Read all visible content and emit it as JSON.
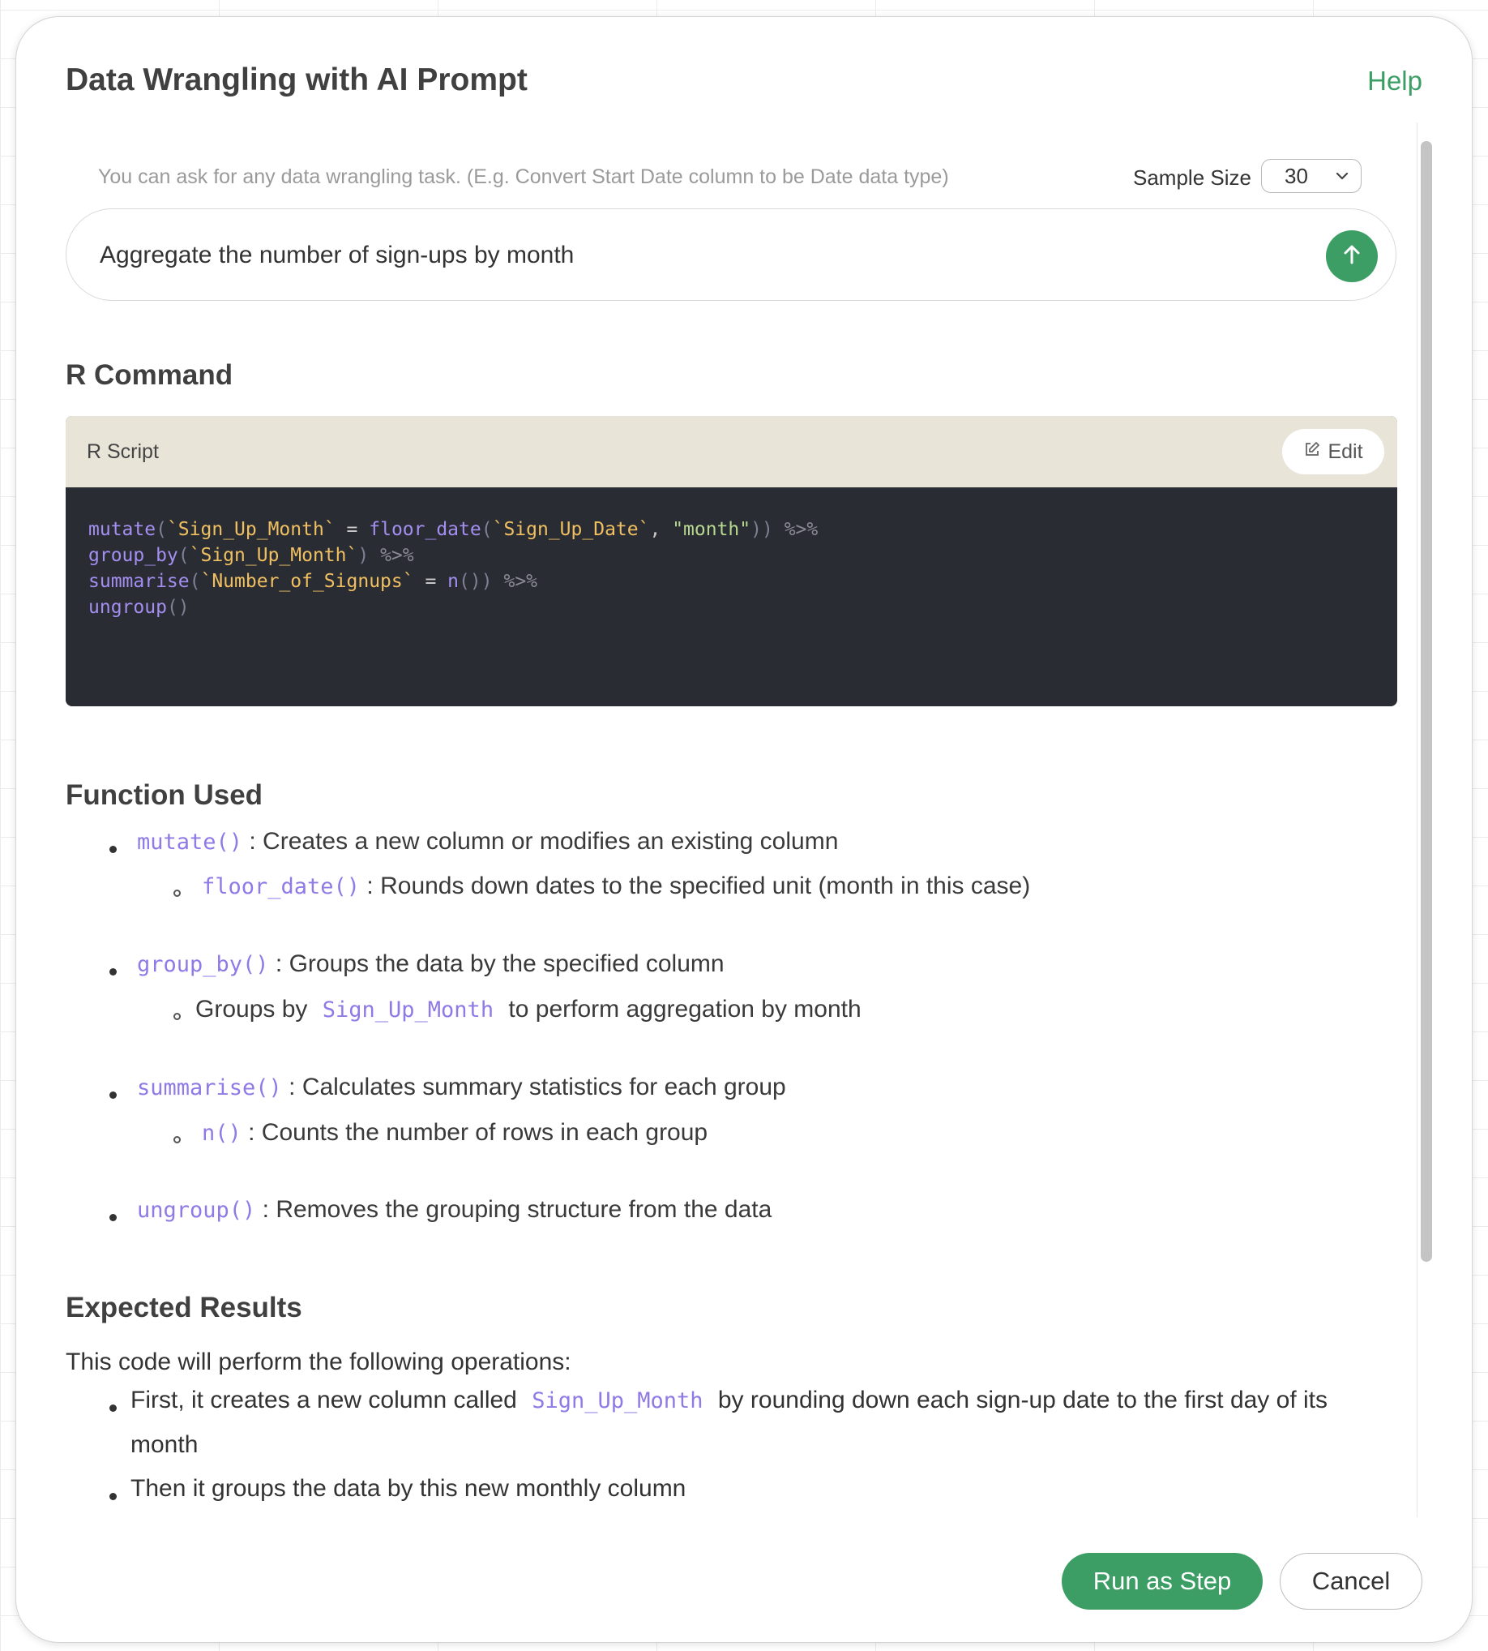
{
  "dialog": {
    "title": "Data Wrangling with AI Prompt",
    "help": "Help"
  },
  "prompt": {
    "hint": "You can ask for any data wrangling task. (E.g. Convert Start Date column to be Date data type)",
    "sample_size_label": "Sample Size",
    "sample_size_value": "30",
    "text": "Aggregate the number of sign-ups by month",
    "send_icon": "arrow-up-icon"
  },
  "r_command": {
    "heading": "R Command",
    "panel_label": "R Script",
    "edit_label": "Edit",
    "code_lines": [
      "mutate(`Sign_Up_Month` = floor_date(`Sign_Up_Date`, \"month\")) %>%",
      "group_by(`Sign_Up_Month`) %>%",
      "summarise(`Number_of_Signups` = n()) %>%",
      "ungroup()"
    ]
  },
  "functions": {
    "heading": "Function Used",
    "items": [
      {
        "code": "mutate()",
        "desc": ": Creates a new column or modifies an existing column",
        "sub": {
          "prefix": "",
          "code": "floor_date()",
          "desc": ": Rounds down dates to the specified unit (month in this case)"
        }
      },
      {
        "code": "group_by()",
        "desc": ": Groups the data by the specified column",
        "sub": {
          "prefix": "Groups by",
          "code": "Sign_Up_Month",
          "desc": "to perform aggregation by month"
        }
      },
      {
        "code": "summarise()",
        "desc": ": Calculates summary statistics for each group",
        "sub": {
          "prefix": "",
          "code": "n()",
          "desc": ": Counts the number of rows in each group"
        }
      },
      {
        "code": "ungroup()",
        "desc": ": Removes the grouping structure from the data"
      }
    ]
  },
  "expected": {
    "heading": "Expected Results",
    "intro": "This code will perform the following operations:",
    "bullets": [
      {
        "prefix": "First, it creates a new column called",
        "code": "Sign_Up_Month",
        "suffix": "by rounding down each sign-up date to the first day of its",
        "suffix2": "month"
      },
      {
        "text": "Then it groups the data by this new monthly column"
      }
    ]
  },
  "footer": {
    "run_label": "Run as Step",
    "cancel_label": "Cancel"
  },
  "colors": {
    "accent": "#3c9e65",
    "code_bg": "#2a2c34",
    "code_header_bg": "#e8e4d8",
    "code_function": "#a48ef0",
    "code_backtick": "#f0c060",
    "code_string": "#b7d98f"
  }
}
